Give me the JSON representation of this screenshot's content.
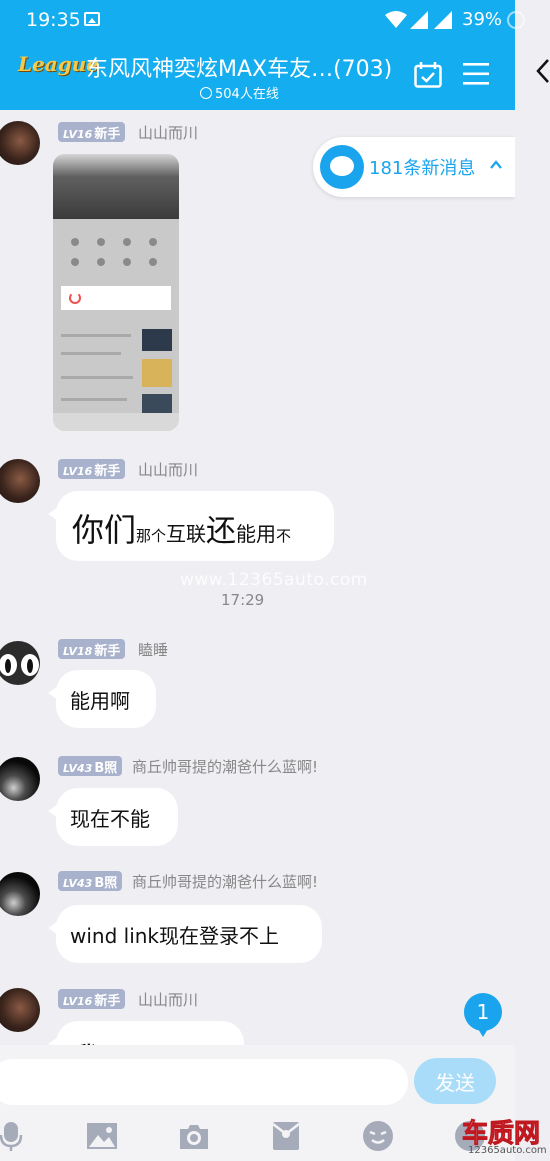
{
  "status_bar": {
    "time": "19:35",
    "battery": "39%"
  },
  "header": {
    "logo_text": "League",
    "title": "东风风神奕炫MAX车友…(703)",
    "online": "504人在线"
  },
  "new_messages": {
    "label": "181条新消息"
  },
  "messages": [
    {
      "level": "LV16",
      "rank": "新手",
      "nick": "山山而川",
      "type": "image"
    },
    {
      "level": "LV16",
      "rank": "新手",
      "nick": "山山而川",
      "text_parts": [
        "你们",
        "那个",
        "互联",
        "还",
        "能用",
        "不"
      ]
    },
    {
      "level": "LV18",
      "rank": "新手",
      "nick": "瞌睡",
      "text": "能用啊"
    },
    {
      "level": "LV43",
      "rank": "B照",
      "nick": "商丘帅哥提的潮爸什么蓝啊!",
      "text": "现在不能"
    },
    {
      "level": "LV43",
      "rank": "B照",
      "nick": "商丘帅哥提的潮爸什么蓝啊!",
      "text": "wind link现在登录不上"
    },
    {
      "level": "LV16",
      "rank": "新手",
      "nick": "山山而川",
      "text": "我 不"
    }
  ],
  "timestamp": "17:29",
  "watermark": "www.12365auto.com",
  "unread_count": "1",
  "input": {
    "placeholder": "",
    "send_label": "发送"
  },
  "site_logo": {
    "text": "车质网",
    "sub": "12365auto.com"
  },
  "colors": {
    "header": "#13adf0",
    "accent": "#1aa4ee",
    "badge": "#a9b2cc"
  }
}
